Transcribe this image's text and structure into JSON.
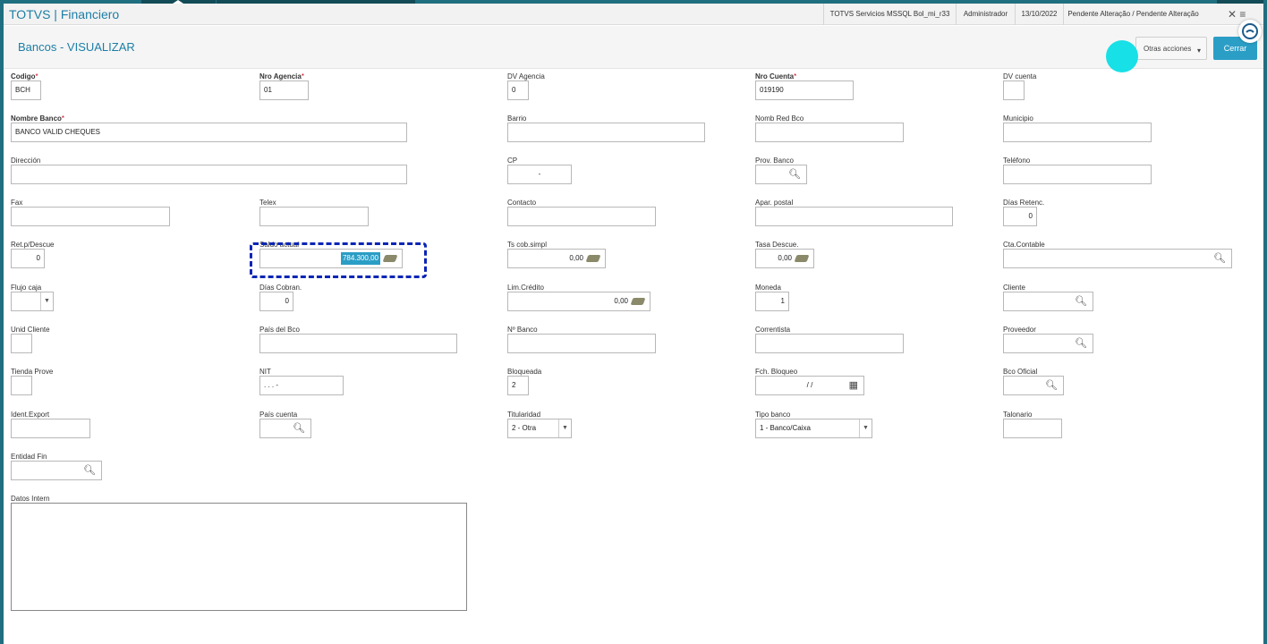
{
  "titlebar": {
    "app_title": "TOTVS | Financiero",
    "server": "TOTVS Servicios MSSQL Bol_mi_r33",
    "user": "Administrador",
    "date": "13/10/2022",
    "pending": "Pendente Alteração / Pendente Alteração",
    "close": "✕ ≡"
  },
  "header": {
    "title": "Bancos - VISUALIZAR",
    "otras_acciones": "Otras acciones",
    "cerrar": "Cerrar"
  },
  "form": {
    "codigo": {
      "label": "Codigo",
      "value": "BCH"
    },
    "nro_agencia": {
      "label": "Nro Agencia",
      "value": "01"
    },
    "dv_agencia": {
      "label": "DV Agencia",
      "value": "0"
    },
    "nro_cuenta": {
      "label": "Nro Cuenta",
      "value": "019190"
    },
    "dv_cuenta": {
      "label": "DV cuenta",
      "value": ""
    },
    "nombre_banco": {
      "label": "Nombre Banco",
      "value": "BANCO VALID CHEQUES"
    },
    "barrio": {
      "label": "Barrio",
      "value": ""
    },
    "nomb_red_bco": {
      "label": "Nomb Red Bco",
      "value": ""
    },
    "municipio": {
      "label": "Municipio",
      "value": ""
    },
    "direccion": {
      "label": "Dirección",
      "value": ""
    },
    "cp": {
      "label": "CP",
      "value": "-"
    },
    "prov_banco": {
      "label": "Prov. Banco",
      "value": ""
    },
    "telefono": {
      "label": "Teléfono",
      "value": ""
    },
    "fax": {
      "label": "Fax",
      "value": ""
    },
    "telex": {
      "label": "Telex",
      "value": ""
    },
    "contacto": {
      "label": "Contacto",
      "value": ""
    },
    "apar_postal": {
      "label": "Apar. postal",
      "value": ""
    },
    "dias_retenc": {
      "label": "Días Retenc.",
      "value": "0"
    },
    "ret_p_descue": {
      "label": "Ret.p/Descue",
      "value": "0"
    },
    "saldo_actual": {
      "label": "Saldo actual",
      "value": "784.300,00"
    },
    "ts_cob_simpl": {
      "label": "Ts cob.simpl",
      "value": "0,00"
    },
    "tasa_descue": {
      "label": "Tasa Descue.",
      "value": "0,00"
    },
    "cta_contable": {
      "label": "Cta.Contable",
      "value": ""
    },
    "flujo_caja": {
      "label": "Flujo caja",
      "value": ""
    },
    "dias_cobran": {
      "label": "Días Cobran.",
      "value": "0"
    },
    "lim_credito": {
      "label": "Lim.Crédito",
      "value": "0,00"
    },
    "moneda": {
      "label": "Moneda",
      "value": "1"
    },
    "cliente": {
      "label": "Cliente",
      "value": ""
    },
    "unid_cliente": {
      "label": "Unid Cliente",
      "value": ""
    },
    "pais_del_bco": {
      "label": "País del Bco",
      "value": ""
    },
    "n_banco": {
      "label": "Nº Banco",
      "value": ""
    },
    "correntista": {
      "label": "Correntista",
      "value": ""
    },
    "proveedor": {
      "label": "Proveedor",
      "value": ""
    },
    "tienda_prove": {
      "label": "Tienda Prove",
      "value": ""
    },
    "nit": {
      "label": "NIT",
      "value": ". . . -"
    },
    "bloqueada": {
      "label": "Bloqueada",
      "value": "2"
    },
    "fch_bloqueo": {
      "label": "Fch. Bloqueo",
      "value": "/ /"
    },
    "bco_oficial": {
      "label": "Bco Oficial",
      "value": ""
    },
    "ident_export": {
      "label": "Ident.Export",
      "value": ""
    },
    "pais_cuenta": {
      "label": "País cuenta",
      "value": ""
    },
    "titularidad": {
      "label": "Titularidad",
      "value": "2 - Otra"
    },
    "tipo_banco": {
      "label": "Tipo banco",
      "value": "1 - Banco/Caixa"
    },
    "talonario": {
      "label": "Talonario",
      "value": ""
    },
    "entidad_fin": {
      "label": "Entidad Fin",
      "value": ""
    },
    "datos_intern": {
      "label": "Datos Intern",
      "value": ""
    }
  },
  "icons": {
    "search": "magnifier",
    "money": "money-bills",
    "calendar": "calendar",
    "dropdown": "triangle-down"
  },
  "colors": {
    "brand": "#1c7ea6",
    "accent_button": "#2b9ec6",
    "focus_outline": "#0b25b5",
    "required": "#d0021b"
  }
}
